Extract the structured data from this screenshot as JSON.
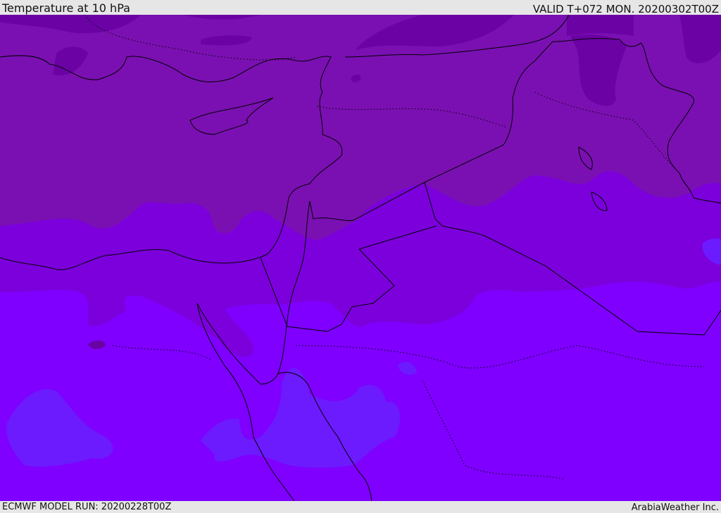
{
  "header": {
    "title": "Temperature at 10 hPa",
    "valid": "VALID T+072 MON. 20200302T00Z"
  },
  "footer": {
    "model_run": "ECMWF MODEL RUN: 20200228T00Z",
    "credit": "ArabiaWeather Inc."
  },
  "map": {
    "region": "Eastern Mediterranean / Middle East",
    "colors": {
      "dark": "#6a02a4",
      "upper": "#7a10b2",
      "middle": "#7c00dc",
      "lower": "#7f00ff",
      "cold": "#6c1bff",
      "coast": "#000000"
    }
  }
}
